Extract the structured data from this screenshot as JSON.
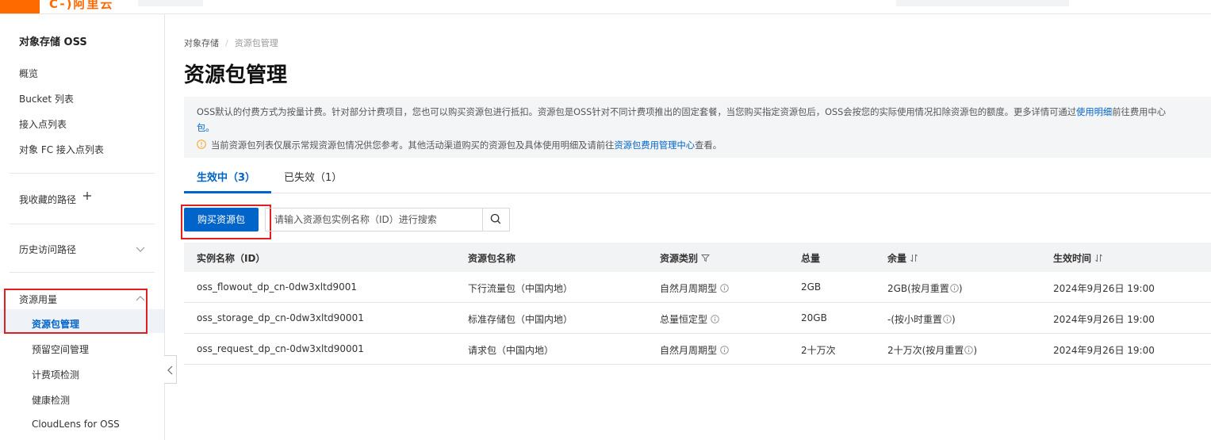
{
  "topbar": {
    "logo_text": "C-)阿里云"
  },
  "sidebar": {
    "title": "对象存储 OSS",
    "items": [
      "概览",
      "Bucket 列表",
      "接入点列表",
      "对象 FC 接入点列表"
    ],
    "favorites_label": "我收藏的路径",
    "history_label": "历史访问路径",
    "resource_group_label": "资源用量",
    "resource_items": [
      "资源包管理",
      "预留空间管理",
      "计费项检测",
      "健康检测",
      "CloudLens for OSS"
    ]
  },
  "breadcrumb": {
    "root": "对象存储",
    "current": "资源包管理"
  },
  "page_title": "资源包管理",
  "notice": {
    "text_before": "OSS默认的付费方式为按量计费。针对部分计费项目，您也可以购买资源包进行抵扣。资源包是OSS针对不同计费项推出的固定套餐，当您购买指定资源包后，OSS会按您的实际使用情况扣除资源包的额度。更多详情可通过",
    "link1": "使用明细",
    "text_middle": "前往费用中心",
    "text_line2": "包。",
    "warn_before": "当前资源包列表仅展示常规资源包情况供您参考。其他活动渠道购买的资源包及具体使用明细及请前往",
    "warn_link": "资源包费用管理中心",
    "warn_after": "查看。"
  },
  "tabs": {
    "active": "生效中（3）",
    "inactive": "已失效（1）"
  },
  "toolbar": {
    "buy_label": "购买资源包",
    "search_placeholder": "请输入资源包实例名称（ID）进行搜索"
  },
  "table": {
    "headers": [
      "实例名称（ID）",
      "资源包名称",
      "资源类别",
      "总量",
      "余量",
      "生效时间"
    ],
    "rows": [
      [
        "oss_flowout_dp_cn-0dw3xltd9001",
        "下行流量包（中国内地）",
        "自然月周期型",
        "2GB",
        "2GB(按月重置",
        "2024年9月26日 19:00"
      ],
      [
        "oss_storage_dp_cn-0dw3xltd90001",
        "标准存储包（中国内地）",
        "总量恒定型",
        "20GB",
        "-(按小时重置",
        "2024年9月26日 19:00"
      ],
      [
        "oss_request_dp_cn-0dw3xltd90001",
        "请求包（中国内地）",
        "自然月周期型",
        "2十万次",
        "2十万次(按月重置",
        "2024年9月26日 19:00"
      ]
    ],
    "remaining_suffix": ")"
  },
  "colors": {
    "primary": "#0064c8",
    "brand": "#ff6a00",
    "highlight_border": "#e02020"
  }
}
